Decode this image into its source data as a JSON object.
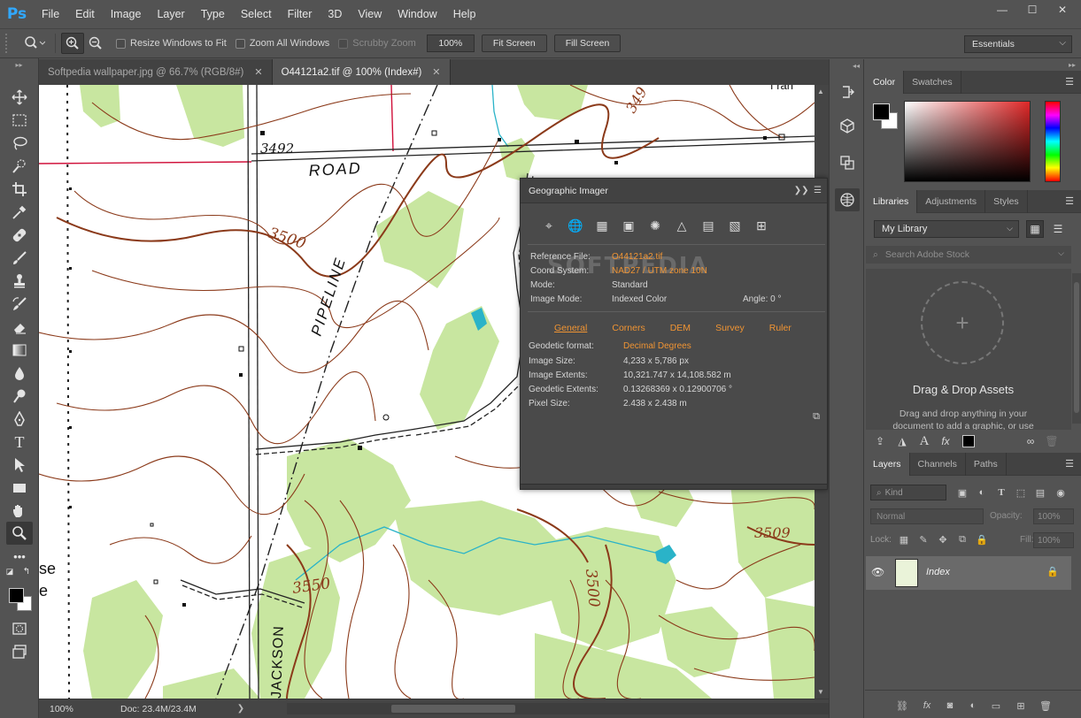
{
  "app": {
    "logo": "Ps"
  },
  "menu": [
    "File",
    "Edit",
    "Image",
    "Layer",
    "Type",
    "Select",
    "Filter",
    "3D",
    "View",
    "Window",
    "Help"
  ],
  "window_controls": {
    "minimize": "—",
    "maximize": "☐",
    "close": "✕"
  },
  "options_bar": {
    "resize_windows": "Resize Windows to Fit",
    "zoom_all": "Zoom All Windows",
    "scrubby_zoom": "Scrubby Zoom",
    "zoom_value": "100%",
    "fit_screen": "Fit Screen",
    "fill_screen": "Fill Screen",
    "workspace": "Essentials"
  },
  "tabs": [
    {
      "label": "Softpedia wallpaper.jpg @ 66.7% (RGB/8#)",
      "active": false
    },
    {
      "label": "O44121a2.tif @ 100% (Index#)",
      "active": true
    }
  ],
  "map_labels": {
    "road": "ROAD",
    "pipeline": "PIPELINE",
    "elev_3492": "3492",
    "elev_3500": "3500",
    "elev_3500b": "3500",
    "elev_3550": "3550",
    "elev_3509": "3509",
    "elev_349": "349",
    "jackson": "JACKSON",
    "se": "se",
    "e": "e",
    "fraction": "f ran"
  },
  "status": {
    "zoom": "100%",
    "doc": "Doc: 23.4M/23.4M"
  },
  "geo_panel": {
    "title": "Geographic Imager",
    "watermark": "SOFTPEDIA",
    "info": [
      {
        "key": "Reference File:",
        "value": "O44121a2.tif",
        "orange": true
      },
      {
        "key": "Coord System:",
        "value": "NAD27 / UTM zone 10N",
        "orange": true
      },
      {
        "key": "Mode:",
        "value": "Standard",
        "orange": false
      },
      {
        "key": "Image Mode:",
        "value": "Indexed Color",
        "orange": false
      }
    ],
    "angle": "Angle:  0 °",
    "tabs": [
      "General",
      "Corners",
      "DEM",
      "Survey",
      "Ruler"
    ],
    "details": [
      {
        "key": "Geodetic format:",
        "value": "Decimal Degrees",
        "orange": true
      },
      {
        "key": "Image Size:",
        "value": "4,233 x 5,786 px",
        "orange": false
      },
      {
        "key": "Image Extents:",
        "value": "10,321.747 x 14,108.582 m",
        "orange": false
      },
      {
        "key": "Geodetic Extents:",
        "value": "0.13268369 x 0.12900706 °",
        "orange": false
      },
      {
        "key": "Pixel Size:",
        "value": "2.438 x 2.438 m",
        "orange": false
      }
    ]
  },
  "color_panel": {
    "tabs": [
      "Color",
      "Swatches"
    ],
    "fg": "#000000",
    "bg": "#ffffff"
  },
  "libraries_panel": {
    "tabs": [
      "Libraries",
      "Adjustments",
      "Styles"
    ],
    "library": "My Library",
    "search_placeholder": "Search Adobe Stock",
    "drag_title": "Drag & Drop Assets",
    "drag_desc": "Drag and drop anything in your document to add a graphic, or use"
  },
  "layers_panel": {
    "tabs": [
      "Layers",
      "Channels",
      "Paths"
    ],
    "filter": "Kind",
    "blend": "Normal",
    "opacity_label": "Opacity:",
    "opacity": "100%",
    "lock_label": "Lock:",
    "fill_label": "Fill:",
    "fill": "100%",
    "layer_name": "Index"
  },
  "colors": {
    "accent_orange": "#f09433",
    "contour_brown": "#8b3a1a",
    "veg_green": "#c8e6a0",
    "water_cyan": "#2ab3c8",
    "boundary_red": "#d0103a"
  }
}
